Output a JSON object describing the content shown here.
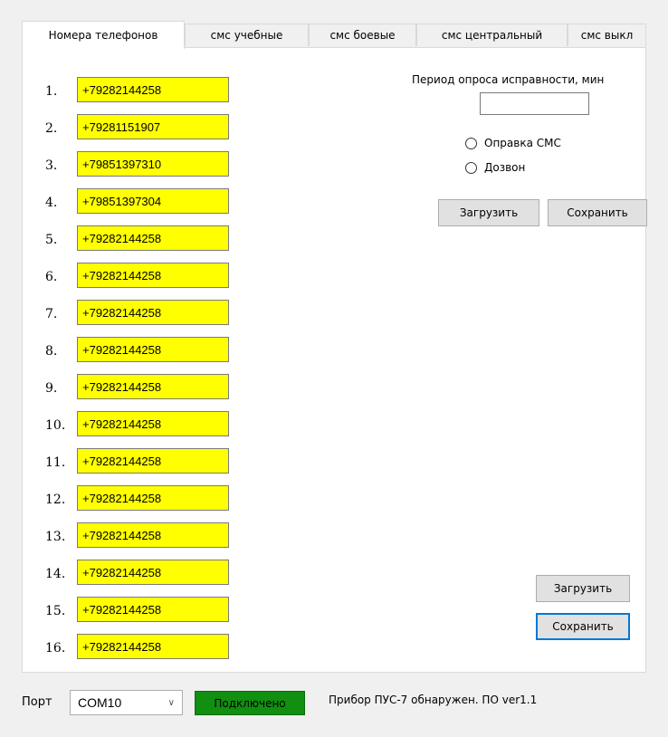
{
  "tabs": [
    {
      "label": "Номера телефонов",
      "active": true
    },
    {
      "label": "смс учебные",
      "active": false
    },
    {
      "label": "смс боевые",
      "active": false
    },
    {
      "label": "смс центральный",
      "active": false
    },
    {
      "label": "смс выкл",
      "active": false
    }
  ],
  "phones": [
    {
      "num": "1.",
      "value": "+79282144258"
    },
    {
      "num": "2.",
      "value": "+79281151907"
    },
    {
      "num": "3.",
      "value": "+79851397310"
    },
    {
      "num": "4.",
      "value": "+79851397304"
    },
    {
      "num": "5.",
      "value": "+79282144258"
    },
    {
      "num": "6.",
      "value": "+79282144258"
    },
    {
      "num": "7.",
      "value": "+79282144258"
    },
    {
      "num": "8.",
      "value": "+79282144258"
    },
    {
      "num": "9.",
      "value": "+79282144258"
    },
    {
      "num": "10.",
      "value": "+79282144258"
    },
    {
      "num": "11.",
      "value": "+79282144258"
    },
    {
      "num": "12.",
      "value": "+79282144258"
    },
    {
      "num": "13.",
      "value": "+79282144258"
    },
    {
      "num": "14.",
      "value": "+79282144258"
    },
    {
      "num": "15.",
      "value": "+79282144258"
    },
    {
      "num": "16.",
      "value": "+79282144258"
    }
  ],
  "period": {
    "label": "Период опроса исправности, мин",
    "value": ""
  },
  "radios": {
    "sms": "Оправка СМС",
    "call": "Дозвон"
  },
  "buttons": {
    "load_top": "Загрузить",
    "save_top": "Сохранить",
    "load_bottom": "Загрузить",
    "save_bottom": "Сохранить"
  },
  "bottom": {
    "port_label": "Порт",
    "port_value": "COM10",
    "connected": "Подключено",
    "status": "Прибор ПУС-7 обнаружен. ПО ver1.1"
  },
  "colors": {
    "phone_bg": "#ffff00",
    "connected_bg": "#108f10",
    "focus": "#0078d7"
  }
}
